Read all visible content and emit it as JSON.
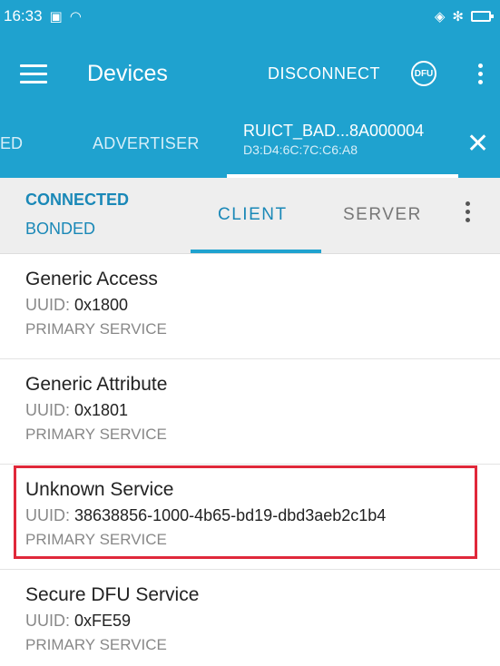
{
  "status_bar": {
    "time": "16:33"
  },
  "app_bar": {
    "title": "Devices",
    "disconnect_label": "DISCONNECT",
    "dfu_label": "DFU"
  },
  "device_tabs": {
    "partial_tab": "ED",
    "advertiser_tab": "ADVERTISER",
    "device_name": "RUICT_BAD...8A000004",
    "device_address": "D3:D4:6C:7C:C6:A8"
  },
  "connection": {
    "status": "CONNECTED",
    "bond": "BONDED",
    "client_tab": "CLIENT",
    "server_tab": "SERVER"
  },
  "uuid_label": "UUID: ",
  "services": [
    {
      "name": "Generic Access",
      "uuid": "0x1800",
      "type": "PRIMARY SERVICE"
    },
    {
      "name": "Generic Attribute",
      "uuid": "0x1801",
      "type": "PRIMARY SERVICE"
    },
    {
      "name": "Unknown Service",
      "uuid": "38638856-1000-4b65-bd19-dbd3aeb2c1b4",
      "type": "PRIMARY SERVICE"
    },
    {
      "name": "Secure DFU Service",
      "uuid": "0xFE59",
      "type": "PRIMARY SERVICE"
    }
  ]
}
